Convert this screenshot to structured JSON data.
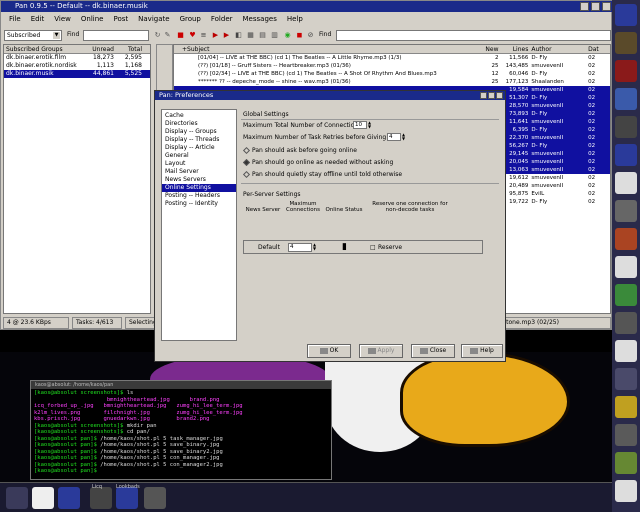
{
  "pan_window": {
    "title": "Pan 0.9.5 -- Default -- dk.binaer.musik",
    "menu": [
      "File",
      "Edit",
      "View",
      "Online",
      "Post",
      "Navigate",
      "Group",
      "Folder",
      "Messages",
      "Help"
    ],
    "toolbar": {
      "subscribed_combo": "Subscribed",
      "find_label_left": "Find",
      "find_label_right": "Find"
    },
    "group_list": {
      "headers": {
        "name": "Subscribed Groups",
        "unread": "Unread",
        "total": "Total"
      },
      "rows": [
        {
          "name": "dk.binaer.erotik.film",
          "unread": "18,273",
          "total": "2,595",
          "selected": false
        },
        {
          "name": "dk.binaer.erotik.nordisk",
          "unread": "1,113",
          "total": "1,168",
          "selected": false
        },
        {
          "name": "dk.binaer.musik",
          "unread": "44,861",
          "total": "5,525",
          "selected": true
        }
      ]
    },
    "header_list": {
      "headers": {
        "subject": "+Subject",
        "new": "New",
        "lines": "Lines",
        "author": "Author",
        "date": "Dat"
      },
      "rows": [
        {
          "subject": "[01/04] -- LIVE at THE BBC) (cd 1) The Beatles -- A Little Rhyme.mp3 (1/3)",
          "new": "2",
          "lines": "11,566",
          "author": "D- Fly",
          "date": "02",
          "selected": false
        },
        {
          "subject": "(??) [01/18] -- Gruff Sisters -- Heartbreaker.mp3 (01/36)",
          "new": "25",
          "lines": "143,485",
          "author": "smuvevenII",
          "date": "02",
          "selected": false
        },
        {
          "subject": "(??) [02/34] -- LIVE at THE BBC) (cd 1) The Beatles -- A Shot Of Rhythm And Blues.mp3",
          "new": "12",
          "lines": "60,046",
          "author": "D- Fly",
          "date": "02",
          "selected": false
        },
        {
          "subject": "******* ?? -- depeche_mode -- shine -- wav.mp3 (01/36)",
          "new": "25",
          "lines": "177,123",
          "author": "Shaalanden",
          "date": "02",
          "selected": false
        },
        {
          "subject": "",
          "new": "",
          "lines": "19,584",
          "author": "smuvevenII",
          "date": "02",
          "selected": true
        },
        {
          "subject": "",
          "new": "",
          "lines": "51,307",
          "author": "D- Fly",
          "date": "02",
          "selected": true
        },
        {
          "subject": "",
          "new": "",
          "lines": "28,570",
          "author": "smuvevenII",
          "date": "02",
          "selected": true
        },
        {
          "subject": "",
          "new": "",
          "lines": "73,893",
          "author": "D- Fly",
          "date": "02",
          "selected": true
        },
        {
          "subject": "",
          "new": "",
          "lines": "11,641",
          "author": "smuvevenII",
          "date": "02",
          "selected": true
        },
        {
          "subject": "",
          "new": "",
          "lines": "6,395",
          "author": "D- Fly",
          "date": "02",
          "selected": true
        },
        {
          "subject": "",
          "new": "",
          "lines": "22,370",
          "author": "smuvevenII",
          "date": "02",
          "selected": true
        },
        {
          "subject": "",
          "new": "",
          "lines": "56,267",
          "author": "D- Fly",
          "date": "02",
          "selected": true
        },
        {
          "subject": "",
          "new": "",
          "lines": "29,145",
          "author": "smuvevenII",
          "date": "02",
          "selected": true
        },
        {
          "subject": "",
          "new": "",
          "lines": "20,045",
          "author": "smuvevenII",
          "date": "02",
          "selected": true
        },
        {
          "subject": "",
          "new": "",
          "lines": "13,063",
          "author": "smuvevenII",
          "date": "02",
          "selected": true
        },
        {
          "subject": "",
          "new": "",
          "lines": "19,612",
          "author": "smuvevenII",
          "date": "02",
          "selected": false
        },
        {
          "subject": "",
          "new": "",
          "lines": "20,489",
          "author": "smuvevenII",
          "date": "02",
          "selected": false
        },
        {
          "subject": "",
          "new": "",
          "lines": "95,875",
          "author": "EvilL",
          "date": "02",
          "selected": false
        },
        {
          "subject": "",
          "new": "",
          "lines": "19,722",
          "author": "D- Fly",
          "date": "02",
          "selected": false
        }
      ]
    },
    "statusbar": {
      "speed": "4 @ 23.6 KBps",
      "tasks": "Tasks: 4/613",
      "selected": "Selecting 10 of 24",
      "message": "Heart Of Stone.mp3 (02/25)"
    }
  },
  "dialog": {
    "title": "Pan: Preferences",
    "categories": [
      {
        "label": "Cache",
        "selected": false
      },
      {
        "label": "Directories",
        "selected": false
      },
      {
        "label": "Display -- Groups",
        "selected": false
      },
      {
        "label": "Display -- Threads",
        "selected": false
      },
      {
        "label": "Display -- Article",
        "selected": false
      },
      {
        "label": "General",
        "selected": false
      },
      {
        "label": "Layout",
        "selected": false
      },
      {
        "label": "Mail Server",
        "selected": false
      },
      {
        "label": "News Servers",
        "selected": false
      },
      {
        "label": "Online Settings",
        "selected": true
      },
      {
        "label": "Posting -- Headers",
        "selected": false
      },
      {
        "label": "Posting -- Identity",
        "selected": false
      }
    ],
    "global": {
      "title": "Global Settings",
      "max_connections_label": "Maximum Total Number of Connections",
      "max_connections_value": "10",
      "max_retries_label": "Maximum Number of Task Retries before Giving Up",
      "max_retries_value": "4",
      "radio_ask": "Pan should ask before going online",
      "radio_auto": "Pan should go online as needed without asking",
      "radio_quiet": "Pan should quietly stay offline until told otherwise",
      "selected_radio": "auto"
    },
    "per_server": {
      "title": "Per-Server Settings",
      "col_server": "News Server",
      "col_max": "Maximum Connections",
      "col_status": "Online Status",
      "col_reserve": "Reserve one connection for non-decode tasks",
      "row_server": "Default",
      "row_max": "4",
      "row_reserve": "Reserve"
    },
    "buttons": {
      "ok": "OK",
      "apply": "Apply",
      "close": "Close",
      "help": "Help"
    }
  },
  "terminal": {
    "title": "kaos@absolut: /home/kaos/pan",
    "lines": [
      [
        {
          "t": "t-grn",
          "s": "[kaos@absolut screenshots]$ "
        },
        {
          "t": "",
          "s": "ls"
        }
      ],
      [
        {
          "t": "t-dir",
          "s": "                      "
        },
        {
          "t": "t-img",
          "s": "bmnightheartead.jpg      brand.png"
        }
      ],
      [
        {
          "t": "t-img",
          "s": "icq_forbed_up_.jpg   bmnightheartead.jpg   zumg_hi_lee_term.jpg"
        }
      ],
      [
        {
          "t": "t-img",
          "s": "k2lm_lives.png       filchnight.jpg        zumg_hi_lee_term.jpg"
        }
      ],
      [
        {
          "t": "t-img",
          "s": "kbs.prisch.jpg       gnuedarkwn.jpg        brand2.png"
        }
      ],
      [
        {
          "t": "t-grn",
          "s": "[kaos@absolut screenshots]$ "
        },
        {
          "t": "",
          "s": "mkdir pan"
        }
      ],
      [
        {
          "t": "t-grn",
          "s": "[kaos@absolut screenshots]$ "
        },
        {
          "t": "",
          "s": "cd pan/"
        }
      ],
      [
        {
          "t": "t-grn",
          "s": "[kaos@absolut pan]$ "
        },
        {
          "t": "",
          "s": "/home/kaos/shot.pl 5 task_manager.jpg"
        }
      ],
      [
        {
          "t": "t-grn",
          "s": "[kaos@absolut pan]$ "
        },
        {
          "t": "",
          "s": "/home/kaos/shot.pl 5 save_binary.jpg"
        }
      ],
      [
        {
          "t": "t-grn",
          "s": "[kaos@absolut pan]$ "
        },
        {
          "t": "",
          "s": "/home/kaos/shot.pl 5 save_binary2.jpg"
        }
      ],
      [
        {
          "t": "t-grn",
          "s": "[kaos@absolut pan]$ "
        },
        {
          "t": "",
          "s": "/home/kaos/shot.pl 5 con_manager.jpg"
        }
      ],
      [
        {
          "t": "t-grn",
          "s": "[kaos@absolut pan]$ "
        },
        {
          "t": "",
          "s": "/home/kaos/shot.pl 5 con_manager2.jpg"
        }
      ],
      [
        {
          "t": "t-grn",
          "s": "[kaos@absolut pan]$ "
        },
        {
          "t": "",
          "s": ""
        }
      ]
    ]
  },
  "taskbar": {
    "label_a": "Licq",
    "label_b": "Lookbads"
  },
  "dock_icons": [
    "terminal-icon",
    "gimp-icon",
    "fox-icon",
    "monitor-icon",
    "gnome-icon",
    "monitor-icon",
    "tux-icon",
    "triangle-icon",
    "burn-icon",
    "tux-icon",
    "gear-icon",
    "clock-icon",
    "tux-icon",
    "display-icon",
    "qvis-icon",
    "mail-icon",
    "gear-icon",
    "tux-icon"
  ],
  "colors": {
    "selection": "#1010a0",
    "titlebar": "#1a2a8a",
    "panel": "#d4d0c8"
  }
}
